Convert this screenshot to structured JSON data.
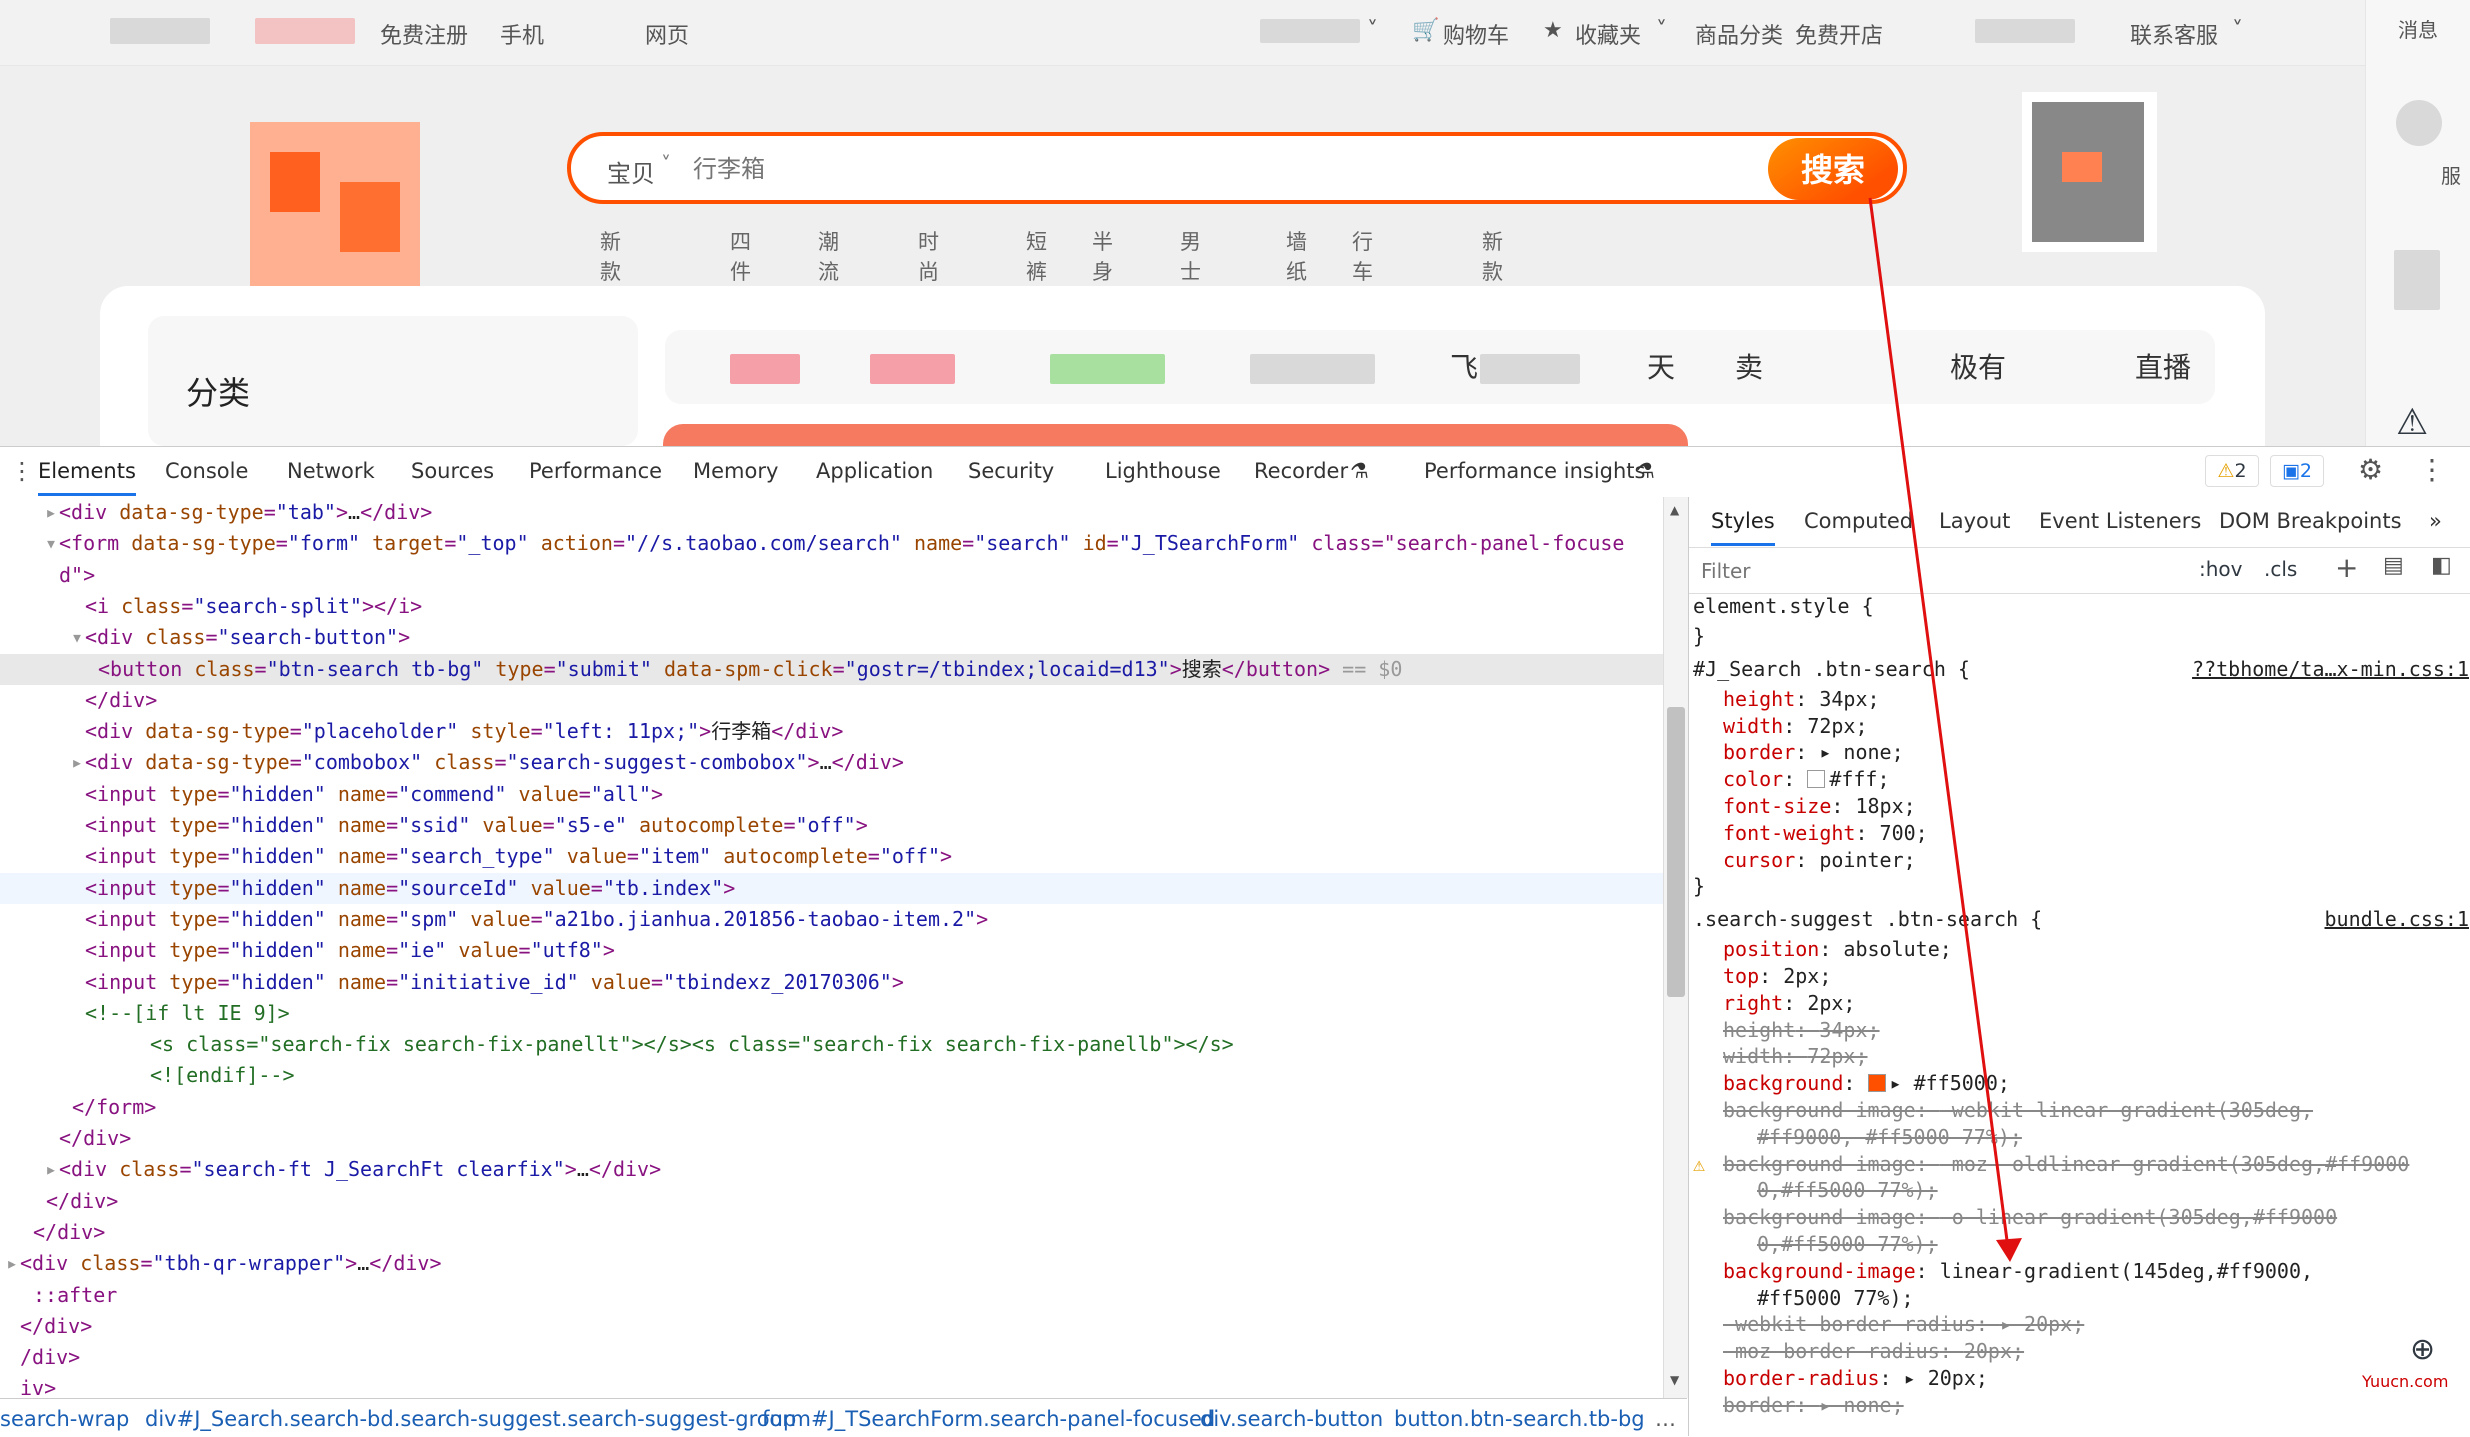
{
  "topbar": {
    "register": "免费注册",
    "mobile": "手机",
    "web": "网页",
    "cart": "购物车",
    "favorites": "收藏夹",
    "categories": "商品分类",
    "open_store": "免费开店",
    "service": "联系客服"
  },
  "rightbar": {
    "messages": "消息",
    "service_label": "服",
    "live": "直播"
  },
  "search": {
    "scope": "宝贝",
    "placeholder": "行李箱",
    "button": "搜索",
    "hot": [
      "新款连衣裙",
      "四件套",
      "潮流T恤",
      "时尚女鞋",
      "短裤",
      "半身裙",
      "男士外套",
      "墙纸",
      "行车记录仪",
      "新款男鞋"
    ]
  },
  "cats": {
    "title": "分类",
    "nav": [
      "飞",
      "天",
      "卖",
      "极有",
      "直播"
    ]
  },
  "devtools": {
    "tabs": [
      "Elements",
      "Console",
      "Network",
      "Sources",
      "Performance",
      "Memory",
      "Application",
      "Security",
      "Lighthouse",
      "Recorder",
      "Performance insights"
    ],
    "warnings": "2",
    "messages": "2",
    "style_tabs": [
      "Styles",
      "Computed",
      "Layout",
      "Event Listeners",
      "DOM Breakpoints"
    ],
    "filter_placeholder": "Filter",
    "hov": ":hov",
    "cls": ".cls",
    "breadcrumbs": [
      "search-wrap",
      "div#J_Search.search-bd.search-suggest.search-suggest-group",
      "form#J_TSearchForm.search-panel-focused",
      "div.search-button",
      "button.btn-search.tb-bg"
    ]
  },
  "watermark": "Yuucn.com",
  "colors": {
    "accent": "#ff5000",
    "accent2": "#ff9000",
    "selected_row": "#e8e8e8"
  },
  "code_lines": [
    {
      "indent": 3,
      "t": "<div data-sg-type=\"tab\">…</div>",
      "arrow": "right"
    },
    {
      "indent": 3,
      "t": "<form data-sg-type=\"form\" target=\"_top\" action=\"//s.taobao.com/search\" name=\"search\" id=\"J_TSearchForm\" class=\"search-panel-focuse",
      "arrow": "down"
    },
    {
      "indent": 3,
      "t": "d\">"
    },
    {
      "indent": 5,
      "t": "<i class=\"search-split\"></i>"
    },
    {
      "indent": 5,
      "t": "<div class=\"search-button\">",
      "arrow": "down"
    },
    {
      "indent": 6,
      "t": "<button class=\"btn-search tb-bg\" type=\"submit\" data-spm-click=\"gostr=/tbindex;locaid=d13\">搜索</button> == $0",
      "sel": true
    },
    {
      "indent": 5,
      "t": "</div>"
    },
    {
      "indent": 5,
      "t": "<div data-sg-type=\"placeholder\" style=\"left: 11px;\">行李箱</div>"
    },
    {
      "indent": 5,
      "t": "<div data-sg-type=\"combobox\" class=\"search-suggest-combobox\">…</div>",
      "arrow": "right"
    },
    {
      "indent": 5,
      "t": "<input type=\"hidden\" name=\"commend\" value=\"all\">"
    },
    {
      "indent": 5,
      "t": "<input type=\"hidden\" name=\"ssid\" value=\"s5-e\" autocomplete=\"off\">"
    },
    {
      "indent": 5,
      "t": "<input type=\"hidden\" name=\"search_type\" value=\"item\" autocomplete=\"off\">"
    },
    {
      "indent": 5,
      "t": "<input type=\"hidden\" name=\"sourceId\" value=\"tb.index\">",
      "hover": true
    },
    {
      "indent": 5,
      "t": "<input type=\"hidden\" name=\"spm\" value=\"a21bo.jianhua.201856-taobao-item.2\">"
    },
    {
      "indent": 5,
      "t": "<input type=\"hidden\" name=\"ie\" value=\"utf8\">"
    },
    {
      "indent": 5,
      "t": "<input type=\"hidden\" name=\"initiative_id\" value=\"tbindexz_20170306\">"
    },
    {
      "indent": 5,
      "t": "<!--[if lt IE 9]>",
      "cmt": true
    },
    {
      "indent": 10,
      "t": "<s class=\"search-fix search-fix-panellt\"></s><s class=\"search-fix search-fix-panellb\"></s>",
      "cmt": true
    },
    {
      "indent": 10,
      "t": "<![endif]-->",
      "cmt": true
    },
    {
      "indent": 4,
      "t": "</form>"
    },
    {
      "indent": 3,
      "t": "</div>"
    },
    {
      "indent": 3,
      "t": "<div class=\"search-ft J_SearchFt clearfix\">…</div>",
      "arrow": "right"
    },
    {
      "indent": 2,
      "t": "</div>"
    },
    {
      "indent": 1,
      "t": "</div>"
    },
    {
      "indent": 0,
      "t": "<div class=\"tbh-qr-wrapper\">…</div>",
      "arrow": "right"
    },
    {
      "indent": 1,
      "t": "::after",
      "pseudo": true
    },
    {
      "indent": 0,
      "t": "</div>"
    },
    {
      "indent": 0,
      "t": "/div>"
    },
    {
      "indent": 0,
      "t": "iv>"
    }
  ],
  "style_lines": [
    {
      "t": "element.style {",
      "sel": true
    },
    {
      "t": "}"
    },
    {
      "t": "#J_Search .btn-search {",
      "sel": true,
      "src": "??tbhome/ta…x-min.css:1"
    },
    {
      "p": "height",
      "v": "34px;"
    },
    {
      "p": "width",
      "v": "72px;"
    },
    {
      "p": "border",
      "v": "▸ none;"
    },
    {
      "p": "color",
      "v": "#fff;",
      "swatch": "#ffffff"
    },
    {
      "p": "font-size",
      "v": "18px;"
    },
    {
      "p": "font-weight",
      "v": "700;"
    },
    {
      "p": "cursor",
      "v": "pointer;"
    },
    {
      "t": "}"
    },
    {
      "t": ".search-suggest .btn-search {",
      "sel": true,
      "src": "bundle.css:1"
    },
    {
      "p": "position",
      "v": "absolute;"
    },
    {
      "p": "top",
      "v": "2px;"
    },
    {
      "p": "right",
      "v": "2px;"
    },
    {
      "p": "height",
      "v": "34px;",
      "s": true
    },
    {
      "p": "width",
      "v": "72px;",
      "s": true
    },
    {
      "p": "background",
      "v": "▸ #ff5000;",
      "swatch": "#ff5000"
    },
    {
      "p": "background-image",
      "v": "-webkit-linear-gradient(305deg,",
      "s": true
    },
    {
      "c": "#ff9000, #ff5000 77%);",
      "s": true
    },
    {
      "p": "background-image",
      "v": "-moz- oldlinear-gradient(305deg,#ff9000",
      "s": true,
      "warn": true
    },
    {
      "c": "0,#ff5000 77%);",
      "s": true
    },
    {
      "p": "background-image",
      "v": "-o-linear-gradient(305deg,#ff9000",
      "s": true
    },
    {
      "c": "0,#ff5000 77%);",
      "s": true
    },
    {
      "p": "background-image",
      "v": "linear-gradient(145deg,#ff9000,"
    },
    {
      "c": "#ff5000 77%);"
    },
    {
      "p": "-webkit-border-radius",
      "v": "▸ 20px;",
      "s": true
    },
    {
      "p": "-moz-border-radius",
      "v": "20px;",
      "s": true
    },
    {
      "p": "border-radius",
      "v": "▸ 20px;"
    },
    {
      "p": "border",
      "v": "▸ none;",
      "s": true
    }
  ]
}
